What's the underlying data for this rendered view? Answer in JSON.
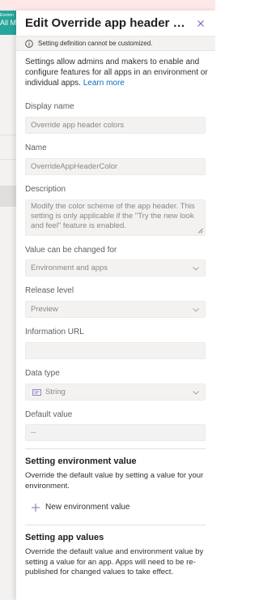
{
  "background": {
    "chip_line1": "Environ",
    "chip_line2": "All My"
  },
  "panel": {
    "title": "Edit Override app header co...",
    "close_label": "×",
    "notice": "Setting definition cannot be customized.",
    "description": "Settings allow admins and makers to enable and configure features for all apps in an environment or individual apps.",
    "learn_more": "Learn more"
  },
  "fields": {
    "display_name": {
      "label": "Display name",
      "value": "Override app header colors"
    },
    "name": {
      "label": "Name",
      "value": "OverrideAppHeaderColor"
    },
    "description": {
      "label": "Description",
      "value": "Modify the color scheme of the app header. This setting is only applicable if the \"Try the new look and feel\" feature is enabled."
    },
    "value_changed_for": {
      "label": "Value can be changed for",
      "value": "Environment and apps"
    },
    "release_level": {
      "label": "Release level",
      "value": "Preview"
    },
    "information_url": {
      "label": "Information URL",
      "value": ""
    },
    "data_type": {
      "label": "Data type",
      "value": "String"
    },
    "default_value": {
      "label": "Default value",
      "value": "--"
    }
  },
  "environment_section": {
    "title": "Setting environment value",
    "text": "Override the default value by setting a value for your environment.",
    "button_label": "New environment value"
  },
  "app_section": {
    "title": "Setting app values",
    "text": "Override the default value and environment value by setting a value for an app. Apps will need to be re-published for changed values to take effect."
  },
  "colors": {
    "accent": "#0f6cbd",
    "close_icon": "#8764b8",
    "chip": "#26a69a",
    "alert_strip": "#fde7e9"
  },
  "icons": [
    "info-icon",
    "close-icon",
    "chevron-down-icon",
    "string-type-icon",
    "plus-icon",
    "resize-grip-icon"
  ]
}
